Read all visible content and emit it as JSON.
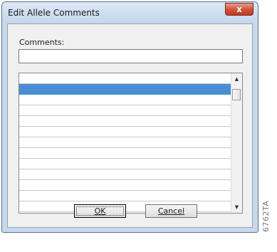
{
  "window": {
    "title": "Edit Allele Comments",
    "close_label": "x"
  },
  "form": {
    "comments_label": "Comments:",
    "comments_value": "",
    "comments_placeholder": ""
  },
  "list": {
    "rows": [
      "",
      "",
      "",
      "",
      "",
      "",
      "",
      "",
      "",
      "",
      "",
      "",
      ""
    ],
    "selected_index": 1
  },
  "scrollbar": {
    "up_arrow": "▲",
    "down_arrow": "▼"
  },
  "buttons": {
    "ok_label": "OK",
    "cancel_label": "Cancel"
  },
  "figure_id": "6762TA",
  "colors": {
    "selection": "#4a8ed2",
    "close_button": "#c9462e",
    "frame": "#c8d9ec"
  }
}
